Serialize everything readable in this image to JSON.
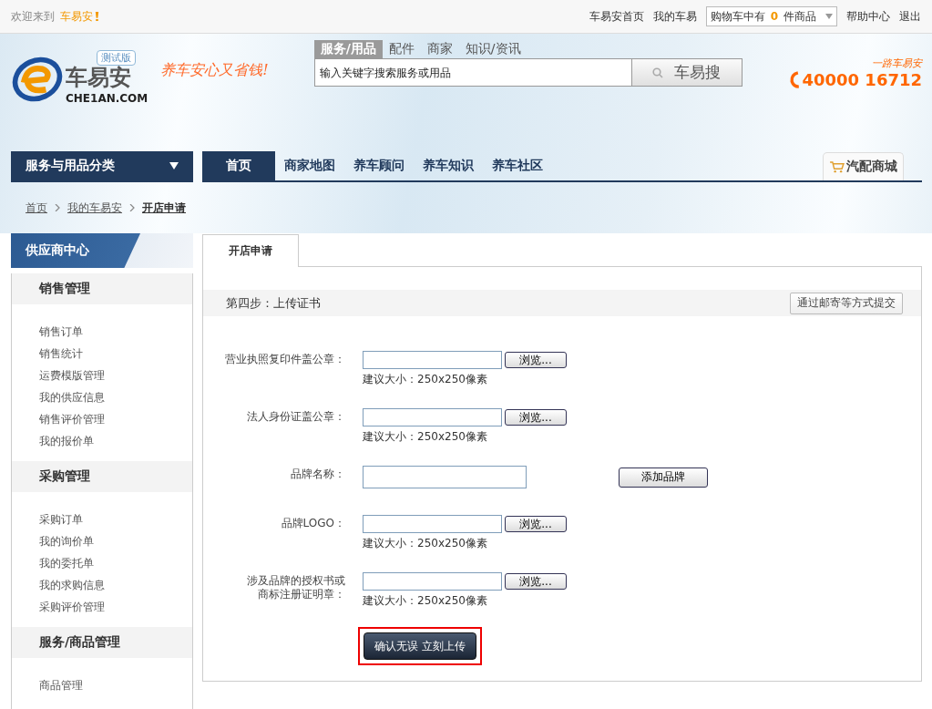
{
  "topbar": {
    "welcome": "欢迎来到",
    "brand": "车易安",
    "links": [
      "车易安首页",
      "我的车易"
    ],
    "cart": {
      "prefix": "购物车中有",
      "count": "0",
      "suffix": "件商品"
    },
    "links_right": [
      "帮助中心",
      "退出"
    ]
  },
  "header": {
    "logo_text": "车易安",
    "logo_domain": "CHE1AN.COM",
    "badge": "测试版",
    "slogan": "养车安心又省钱!",
    "search_tabs": [
      {
        "label": "服务/用品",
        "selected": true
      },
      {
        "label": "配件",
        "selected": false
      },
      {
        "label": "商家",
        "selected": false
      },
      {
        "label": "知识/资讯",
        "selected": false
      }
    ],
    "search": {
      "placeholder": "输入关键字搜索服务或用品"
    },
    "search_button": "车易搜",
    "hotline_caption": "一路车易安",
    "hotline": "40000 16712"
  },
  "nav": {
    "category": "服务与用品分类",
    "items": [
      {
        "label": "首页",
        "selected": true
      },
      {
        "label": "商家地图",
        "selected": false
      },
      {
        "label": "养车顾问",
        "selected": false
      },
      {
        "label": "养车知识",
        "selected": false
      },
      {
        "label": "养车社区",
        "selected": false
      }
    ],
    "mall": "汽配商城"
  },
  "breadcrumb": [
    "首页",
    "我的车易安",
    "开店申请"
  ],
  "sidebar": {
    "title": "供应商中心",
    "sections": [
      {
        "title": "销售管理",
        "items": [
          "销售订单",
          "销售统计",
          "运费模版管理",
          "我的供应信息",
          "销售评价管理",
          "我的报价单"
        ]
      },
      {
        "title": "采购管理",
        "items": [
          "采购订单",
          "我的询价单",
          "我的委托单",
          "我的求购信息",
          "采购评价管理"
        ]
      },
      {
        "title": "服务/商品管理",
        "items": [
          "商品管理"
        ]
      }
    ]
  },
  "main": {
    "tab": "开店申请",
    "step": "第四步：上传证书",
    "mail_button": "通过邮寄等方式提交",
    "fields": [
      {
        "kind": "file",
        "label": [
          "营业执照复印件盖公章："
        ],
        "button": "浏览...",
        "hint": "建议大小：250x250像素"
      },
      {
        "kind": "file",
        "label": [
          "法人身份证盖公章："
        ],
        "button": "浏览...",
        "hint": "建议大小：250x250像素"
      },
      {
        "kind": "text",
        "label": [
          "品牌名称："
        ],
        "button": "添加品牌"
      },
      {
        "kind": "file",
        "label": [
          "品牌LOGO："
        ],
        "button": "浏览...",
        "hint": "建议大小：250x250像素"
      },
      {
        "kind": "file",
        "label": [
          "涉及品牌的授权书或",
          "商标注册证明章："
        ],
        "button": "浏览...",
        "hint": "建议大小：250x250像素"
      }
    ],
    "submit": "确认无误 立刻上传"
  }
}
